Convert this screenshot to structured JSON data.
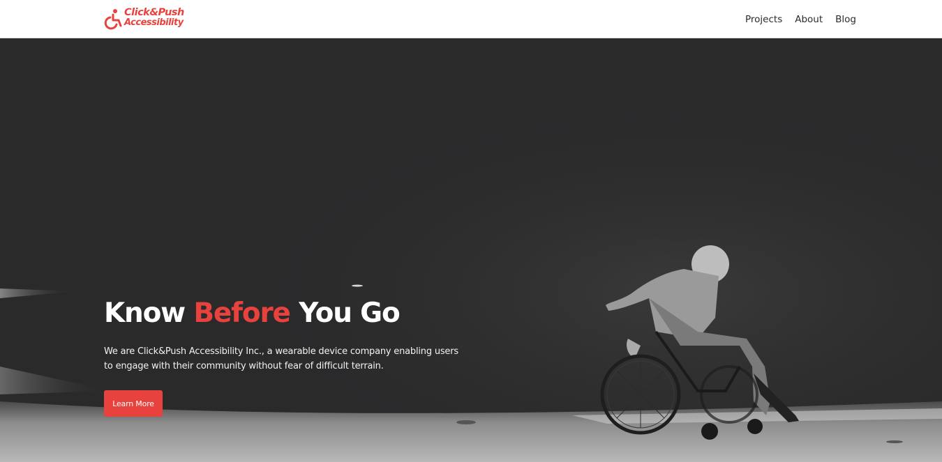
{
  "brand": {
    "line1": "Click&Push",
    "line2": "Accessibility",
    "color": "#e8423f",
    "icon": "wheelchair-icon"
  },
  "nav": {
    "items": [
      {
        "label": "Projects"
      },
      {
        "label": "About"
      },
      {
        "label": "Blog"
      }
    ]
  },
  "hero": {
    "headline_part1": "Know ",
    "headline_accent": "Before",
    "headline_part2": " You Go",
    "description": "We are Click&Push Accessibility Inc., a wearable device company enabling users to engage with their community without fear of difficult terrain.",
    "cta_label": "Learn More",
    "accent_color": "#e8423f",
    "image": "black-and-white photo of a man in a wheelchair on a road"
  }
}
